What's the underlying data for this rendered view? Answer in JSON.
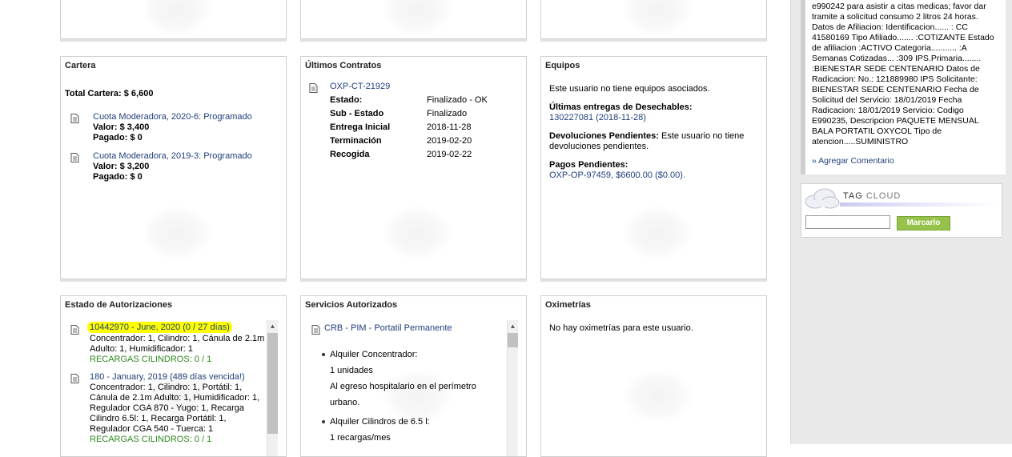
{
  "cartera": {
    "title": "Cartera",
    "total": "Total Cartera: $ 6,600",
    "items": [
      {
        "link": "Cuota Moderadora, 2020-6: Programado",
        "valor": "Valor: $ 3,400",
        "pagado": "Pagado: $ 0"
      },
      {
        "link": "Cuota Moderadora, 2019-3: Programado",
        "valor": "Valor: $ 3,200",
        "pagado": "Pagado: $ 0"
      }
    ]
  },
  "contratos": {
    "title": "Últimos Contratos",
    "contract_id": "OXP-CT-21929",
    "rows": [
      {
        "label": "Estado:",
        "value": "Finalizado - OK"
      },
      {
        "label": "Sub - Estado",
        "value": "Finalizado"
      },
      {
        "label": "Entrega Inicial",
        "value": "2018-11-28"
      },
      {
        "label": "Terminación",
        "value": "2019-02-20"
      },
      {
        "label": "Recogida",
        "value": "2019-02-22"
      }
    ]
  },
  "equipos": {
    "title": "Equipos",
    "none": "Este usuario no tiene equipos asociados.",
    "entregas_label": "Últimas entregas de Desechables:",
    "entregas_value": "130227081 (2018-11-28)",
    "devoluciones_label": "Devoluciones Pendientes:",
    "devoluciones_text1": " Este usuario no tiene",
    "devoluciones_text2": "devoluciones pendientes.",
    "pagos_label": "Pagos Pendientes:",
    "pagos_value": "OXP-OP-97459, $6600.00 ($0.00)."
  },
  "autorizaciones": {
    "title": "Estado de Autorizaciones",
    "items": [
      {
        "link": "10442970 - June, 2020 (0 / 27 días)",
        "lines": [
          "Concentrador: 1, Cilindro: 1, Cánula de 2.1m",
          "Adulto: 1, Humidificador: 1"
        ],
        "recargas": "RECARGAS CILINDROS: 0 / 1"
      },
      {
        "link": "180 - January, 2019 (489 días vencida!)",
        "lines": [
          "Concentrador: 1, Cilindro: 1, Portátil: 1,",
          "Cánula de 2.1m Adulto: 1, Humidificador: 1,",
          "Regulador CGA 870 - Yugo: 1, Recarga",
          "Cilindro 6.5l: 1, Recarga Portátil: 1,",
          "Regulador CGA 540 - Tuerca: 1"
        ],
        "recargas": "RECARGAS CILINDROS: 0 / 1"
      }
    ]
  },
  "servicios": {
    "title": "Servicios Autorizados",
    "service": "CRB - PIM - Portatil Permanente",
    "items": [
      {
        "label": "Alquiler Concentrador:",
        "lines": [
          "1 unidades",
          "Al egreso hospitalario en el perímetro",
          "urbano."
        ]
      },
      {
        "label": "Alquiler Cilindros de 6.5 l:",
        "lines": [
          "1 recargas/mes"
        ]
      }
    ]
  },
  "oximetrias": {
    "title": "Oximetrías",
    "none": "No hay oximetrías para este usuario."
  },
  "comment": {
    "lines": [
      "e990242 para asistir a citas medicas; favor dar",
      "tramite a solicitud consumo 2 litros 24 horas.",
      "Datos de Afiliacion: Identificacion...... : CC",
      "41580169 Tipo Afiliado....... :COTIZANTE Estado",
      "de afiliacion :ACTIVO Categoria........... :A",
      "Semanas Cotizadas... :309 IPS.Primaria........",
      ":BIENESTAR SEDE CENTENARIO Datos de",
      "Radicacion: No.: 121889980 IPS Solicitante:",
      "BIENESTAR SEDE CENTENARIO Fecha de",
      "Solicitud del Servicio: 18/01/2019 Fecha",
      "Radicacion: 18/01/2019 Servicio: Codigo",
      "E990235, Descripcion PAQUETE MENSUAL",
      "BALA PORTATIL OXYCOL Tipo de",
      "atencion.....SUMINISTRO"
    ],
    "add_link": "» Agregar Comentario"
  },
  "tagcloud": {
    "tag_word": "TAG",
    "cloud_word": "CLOUD",
    "input_value": "",
    "button": "Marcarlo"
  }
}
